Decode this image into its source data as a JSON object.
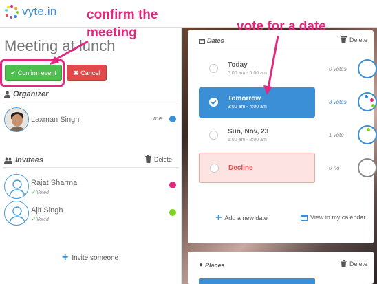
{
  "app": {
    "logo_text": "vyte.in"
  },
  "meeting": {
    "title": "Meeting at lunch"
  },
  "actions": {
    "confirm_label": "Confirm event",
    "cancel_label": "Cancel"
  },
  "organizer": {
    "label": "Organizer",
    "name": "Laxman Singh",
    "tag": "me",
    "dot_color": "#3a8fd6"
  },
  "invitees": {
    "label": "Invitees",
    "delete_label": "Delete",
    "people": [
      {
        "name": "Rajat Sharma",
        "status": "Voted",
        "dot_color": "#e0287e"
      },
      {
        "name": "Ajit Singh",
        "status": "Voted",
        "dot_color": "#7ed321"
      }
    ],
    "invite_label": "Invite someone"
  },
  "dates": {
    "label": "Dates",
    "delete_label": "Delete",
    "options": [
      {
        "title": "Today",
        "time": "5:00 am - 6:00 am",
        "votes": "0 votes",
        "selected": false
      },
      {
        "title": "Tomorrow",
        "time": "3:00 am - 4:00 am",
        "votes": "3 votes",
        "selected": true
      },
      {
        "title": "Sun, Nov, 23",
        "time": "1:00 am - 2:00 am",
        "votes": "1 vote",
        "selected": false
      },
      {
        "title": "Decline",
        "time": "",
        "votes": "0 no",
        "selected": false
      }
    ],
    "add_label": "Add a new date",
    "calendar_label": "View in my calendar"
  },
  "places": {
    "label": "Places",
    "delete_label": "Delete"
  },
  "annotations": {
    "confirm_line1": "confirm the",
    "confirm_line2": "meeting",
    "vote": "vote for a date"
  },
  "colors": {
    "accent": "#3a8fd6",
    "confirm": "#4cbf4f",
    "cancel": "#e04a4a",
    "annotation": "#e0287e"
  }
}
